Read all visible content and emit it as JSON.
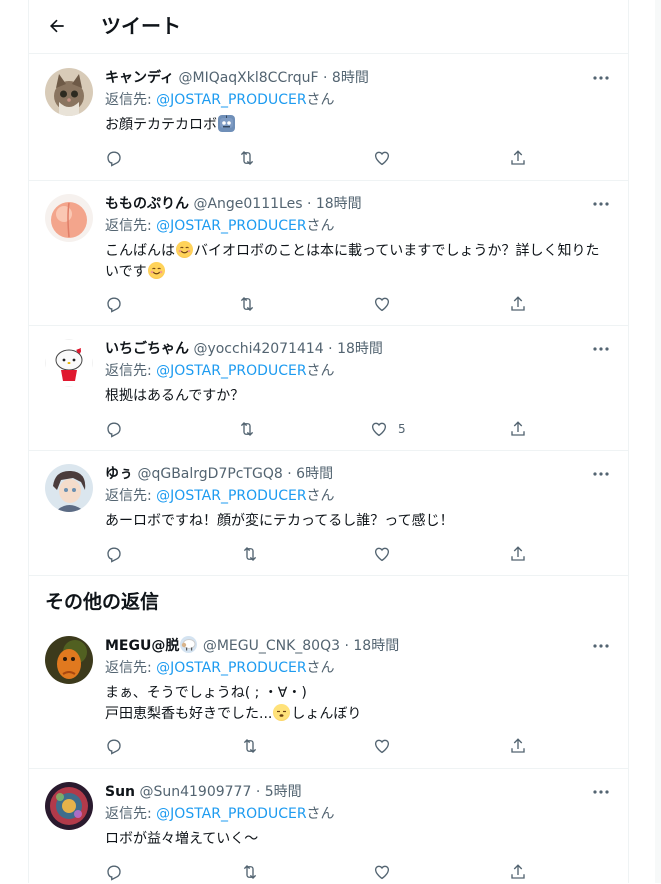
{
  "header": {
    "title": "ツイート"
  },
  "replies": [
    {
      "name": "キャンディ",
      "handle": "@MIQaqXkl8CCrquF",
      "time": "8時間",
      "reply_prefix": "返信先: ",
      "mention": "@JOSTAR_PRODUCER",
      "reply_suffix": "さん",
      "text_part1": "お顔テカテカロボ",
      "emoji": "robot",
      "like_count": ""
    },
    {
      "name": "もものぷりん",
      "handle": "@Ange0111Les",
      "time": "18時間",
      "reply_prefix": "返信先: ",
      "mention": "@JOSTAR_PRODUCER",
      "reply_suffix": "さん",
      "text_part1": "こんばんは",
      "text_part2": "バイオロボのことは本に載っていますでしょうか？詳しく知りたいです",
      "emoji": "smiling-face",
      "like_count": ""
    },
    {
      "name": "いちごちゃん",
      "handle": "@yocchi42071414",
      "time": "18時間",
      "reply_prefix": "返信先: ",
      "mention": "@JOSTAR_PRODUCER",
      "reply_suffix": "さん",
      "text_part1": "根拠はあるんですか？",
      "like_count": "5"
    },
    {
      "name": "ゆぅ",
      "handle": "@qGBalrgD7PcTGQ8",
      "time": "6時間",
      "reply_prefix": "返信先: ",
      "mention": "@JOSTAR_PRODUCER",
      "reply_suffix": "さん",
      "text_part1": "あーロボですね！顔が変にテカってるし誰？って感じ！",
      "like_count": ""
    }
  ],
  "other_replies": {
    "title": "その他の返信",
    "items": [
      {
        "name": "MEGU@脱",
        "name_emoji": "sheep",
        "handle": "@MEGU_CNK_80Q3",
        "time": "18時間",
        "reply_prefix": "返信先: ",
        "mention": "@JOSTAR_PRODUCER",
        "reply_suffix": "さん",
        "text_line1": "まぁ、そうでしょうね( ; ・∀・)",
        "text_line2a": "戸田恵梨香も好きでした...",
        "text_line2b": "しょんぼり",
        "emoji": "sleepy-face",
        "like_count": ""
      },
      {
        "name": "Sun",
        "handle": "@Sun41909777",
        "time": "5時間",
        "reply_prefix": "返信先: ",
        "mention": "@JOSTAR_PRODUCER",
        "reply_suffix": "さん",
        "text_part1": "ロボが益々増えていく～",
        "like_count": ""
      }
    ]
  },
  "colors": {
    "accent": "#1d9bf0",
    "secondary_text": "#536471",
    "divider": "#eff3f4"
  },
  "icons": [
    "back-arrow-icon",
    "more-icon",
    "reply-icon",
    "retweet-icon",
    "like-icon",
    "share-icon"
  ]
}
